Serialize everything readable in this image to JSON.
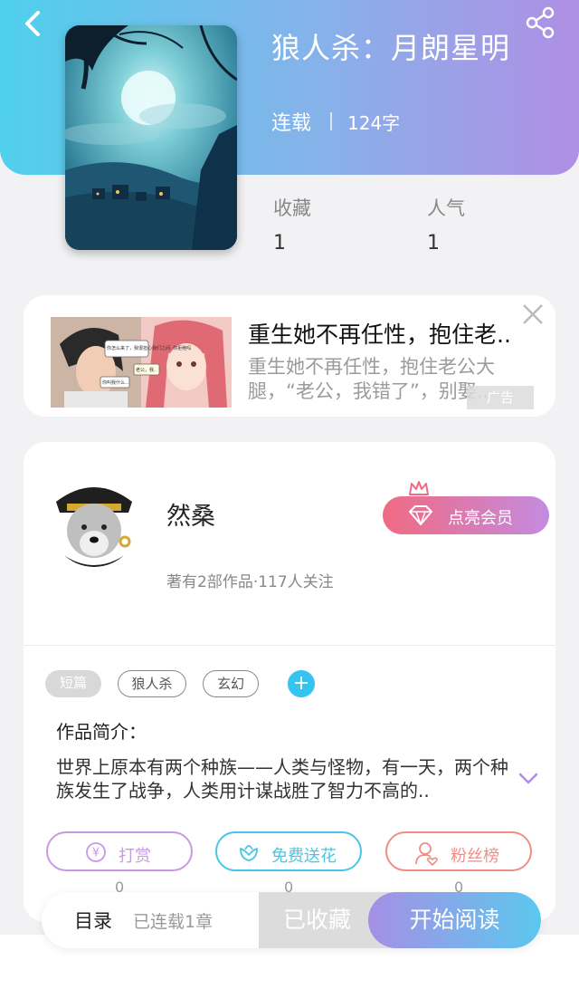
{
  "book": {
    "title": "狼人杀：月朗星明",
    "status": "连载",
    "word_count": "124字",
    "stats": [
      {
        "label": "收藏",
        "value": "1"
      },
      {
        "label": "人气",
        "value": "1"
      }
    ]
  },
  "ad": {
    "title": "重生她不再任性，抱住老..",
    "description": "重生她不再任性，抱住老公大腿，“老公，我错了”，别娶..",
    "tag": "广告",
    "comic_bubbles": [
      "你怎么来了，我很担心我们之间..你拒绝吗",
      "老公，我..",
      "你叫我什么..."
    ]
  },
  "author": {
    "name": "然桑",
    "stats": "著有2部作品·117人关注",
    "vip_label": "点亮会员"
  },
  "tags": [
    "短篇",
    "狼人杀",
    "玄幻"
  ],
  "intro": {
    "title": "作品简介：",
    "text": "世界上原本有两个种族——人类与怪物，有一天，两个种族发生了战争，人类用计谋战胜了智力不高的.."
  },
  "actions": [
    {
      "label": "打赏",
      "count": "0",
      "color": "#c79ae3"
    },
    {
      "label": "免费送花",
      "count": "0",
      "color": "#48c6e6"
    },
    {
      "label": "粉丝榜",
      "count": "0",
      "color": "#ef8e86"
    }
  ],
  "bottom": {
    "toc_label": "目录",
    "toc_info": "已连载1章",
    "favorited_label": "已收藏",
    "read_label": "开始阅读"
  },
  "colors": {
    "header_start": "#4fd0ec",
    "header_end": "#b08fe4",
    "accent_blue": "#35c4f0"
  },
  "icons": [
    "back-arrow-icon",
    "share-icon",
    "close-icon",
    "gem-icon",
    "crown-icon",
    "plus-icon",
    "chevron-down-icon",
    "yen-coin-icon",
    "flower-icon",
    "fan-user-icon"
  ]
}
